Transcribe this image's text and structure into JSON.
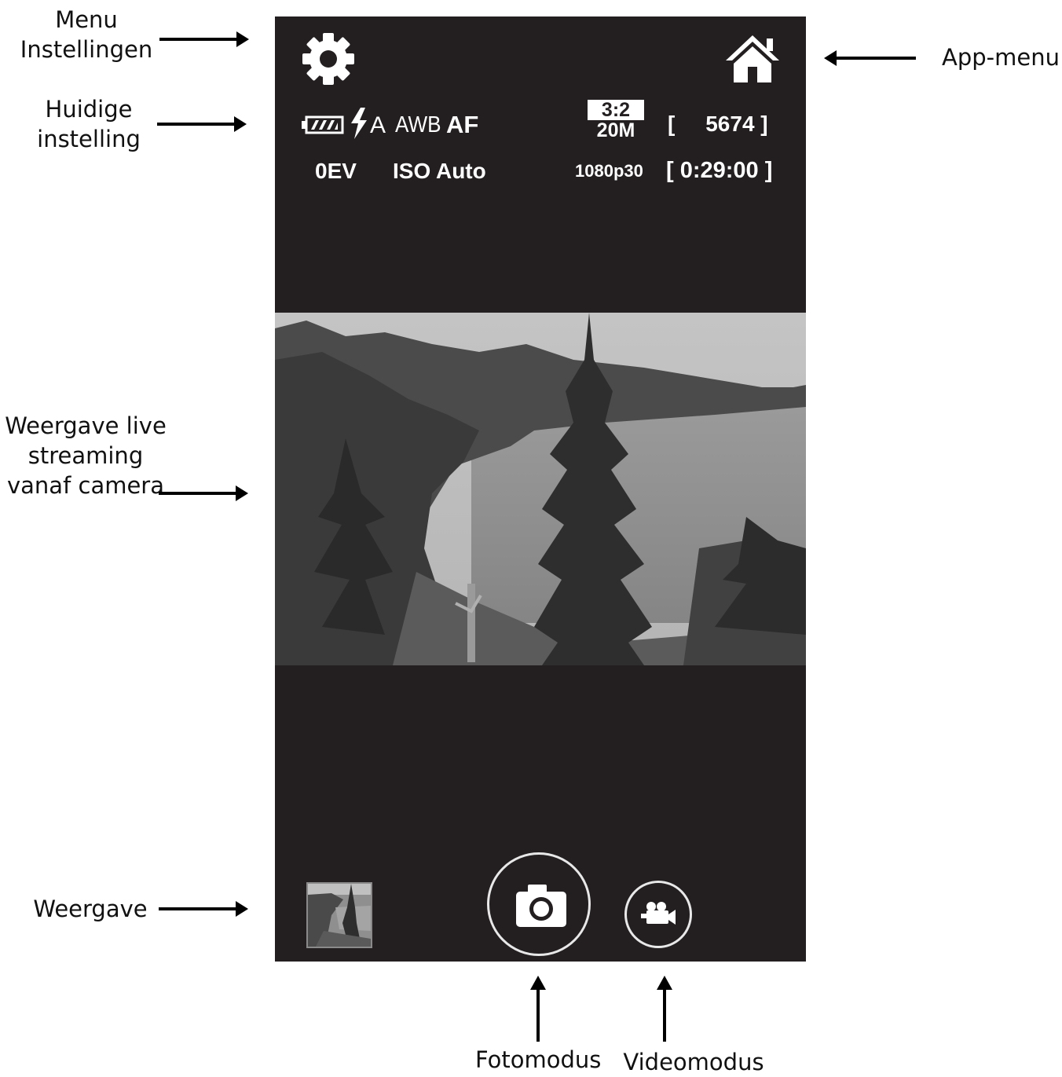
{
  "annotations": {
    "menu_settings": [
      "Menu",
      "Instellingen"
    ],
    "current_setting": [
      "Huidige",
      "instelling"
    ],
    "live_view": [
      "Weergave live",
      "streaming",
      "vanaf camera"
    ],
    "playback": "Weergave",
    "app_menu": "App-menu",
    "photo_mode": "Fotomodus",
    "video_mode": "Videomodus"
  },
  "status": {
    "flash_mode": "A",
    "white_balance": "AWB",
    "focus": "AF",
    "exposure": "0EV",
    "iso": "ISO Auto",
    "aspect_ratio": "3:2",
    "resolution": "20M",
    "shots_remaining": "[     5674 ]",
    "video_format": "1080p30",
    "video_remaining": "[ 0:29:00 ]"
  },
  "icons": {
    "settings": "gear-icon",
    "app_menu": "home-icon",
    "battery": "battery-icon",
    "flash": "flash-icon",
    "photo_mode": "camera-icon",
    "video_mode": "video-camera-icon"
  },
  "colors": {
    "screen_background": "#231f20",
    "icon_foreground": "#ffffff",
    "annotation_text": "#111111"
  }
}
